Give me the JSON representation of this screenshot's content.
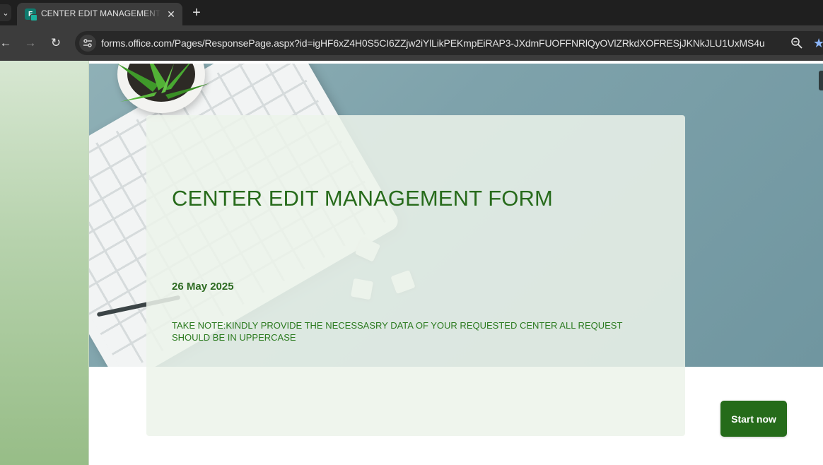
{
  "browser": {
    "tab_title": "CENTER EDIT MANAGEMENT FORM",
    "favicon_letter": "F",
    "tab_close": "✕",
    "new_tab": "+",
    "url": "forms.office.com/Pages/ResponsePage.aspx?id=igHF6xZ4H0S5CI6ZZjw2iYlLikPEKmpEiRAP3-JXdmFUOFFNRlQyOVlZRkdXOFRESjJKNkJLU1UxMS4u",
    "nav": {
      "back": "←",
      "forward": "→",
      "reload": "↻",
      "tab_list": "⌄"
    },
    "star": "★"
  },
  "form": {
    "title": "CENTER EDIT MANAGEMENT FORM",
    "date": "26 May 2025",
    "note": "TAKE NOTE:KINDLY PROVIDE THE NECESSASRY DATA OF YOUR REQUESTED CENTER ALL REQUEST SHOULD BE IN UPPERCASE",
    "start_label": "Start now"
  },
  "colors": {
    "brand_green": "#256b1a",
    "title_green": "#276b1b",
    "hero_blue_gray": "#7ea2ab"
  },
  "icons": [
    "tab-list-icon",
    "forms-favicon-icon",
    "close-icon",
    "plus-icon",
    "back-arrow-icon",
    "forward-arrow-icon",
    "reload-icon",
    "site-info-icon",
    "zoom-icon",
    "bookmark-star-icon"
  ]
}
